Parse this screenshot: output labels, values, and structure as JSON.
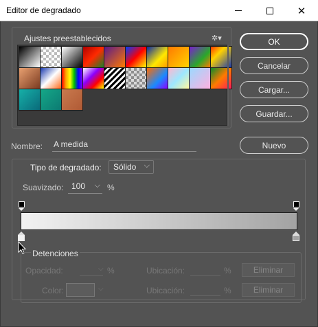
{
  "window": {
    "title": "Editor de degradado",
    "minimize_icon": "minimize-icon",
    "maximize_icon": "maximize-icon",
    "close_icon": "close-icon",
    "close_glyph": "✕"
  },
  "presets": {
    "title": "Ajustes preestablecidos",
    "gear_glyph": "✲▾",
    "gear_icon": "gear-icon",
    "swatches": [
      {
        "bg": "linear-gradient(135deg,#000 0%,#fff 100%)"
      },
      {
        "bg": "repeating-conic-gradient(#bdbdbd 0 25%, #ffffff 0 50%) 0 0/8px 8px"
      },
      {
        "bg": "linear-gradient(135deg,#fff 0%,#000 100%)"
      },
      {
        "bg": "linear-gradient(135deg,#b00000 0%,#ff2a00 50%,#1a7f2a 100%)"
      },
      {
        "bg": "linear-gradient(135deg,#5a1a8a 0%,#ff7a00 100%)"
      },
      {
        "bg": "linear-gradient(135deg,#003cff 0%,#ff0000 50%,#ffff00 100%)"
      },
      {
        "bg": "linear-gradient(135deg,#0a2aa5 0%,#ffe800 60%,#ff9b00 100%)"
      },
      {
        "bg": "linear-gradient(135deg,#ff7a00 0%,#ffd400 100%)"
      },
      {
        "bg": "linear-gradient(135deg,#7a1fd0 0%,#2aa82a 60%,#ff7a00 100%)"
      },
      {
        "bg": "linear-gradient(135deg,#ff3a00 0%,#ffd200 35%,#1a3ab0 100%)"
      },
      {
        "bg": "linear-gradient(135deg,#e8a070 0%,#7a3a20 100%)"
      },
      {
        "bg": "linear-gradient(135deg,#1a3ab0 0%,#ffffff 50%,#ff6a1a 100%)"
      },
      {
        "bg": "linear-gradient(90deg,#ff0000,#ffa500,#ffff00,#00c000,#0000ff,#8b00ff)"
      },
      {
        "bg": "linear-gradient(135deg,#ffffff 0%,#8b00ff 40%,#ff0000 70%,#ffff00 100%)"
      },
      {
        "bg": "repeating-linear-gradient(135deg,#000 0 3px,#ffffff 3px 6px)"
      },
      {
        "bg": "repeating-conic-gradient(#8e8e8e 0 25%, #d9d9d9 0 50%) 0 0/8px 8px"
      },
      {
        "bg": "linear-gradient(135deg,#ff6a00 0%,#1a8aff 60%,#8b00ff 100%)"
      },
      {
        "bg": "linear-gradient(135deg,#ffb7d0 0%,#9de7ff 50%,#fff8a0 100%)"
      },
      {
        "bg": "linear-gradient(135deg,#9bd9ff 0%,#ffb0e0 100%)"
      },
      {
        "bg": "linear-gradient(135deg,#0a8a2a 0%,#ff7a00 50%,#ff1a5a 100%)"
      },
      {
        "bg": "linear-gradient(135deg,#16b0a8 0%,#0a6a7a 100%)"
      },
      {
        "bg": "linear-gradient(135deg,#15a888 0%,#0c7a72 100%)"
      },
      {
        "bg": "linear-gradient(135deg,#c97a4e 0%,#b05a35 100%)"
      }
    ]
  },
  "buttons": {
    "ok": "OK",
    "cancel": "Cancelar",
    "load": "Cargar...",
    "save": "Guardar...",
    "new": "Nuevo"
  },
  "name": {
    "label": "Nombre:",
    "value": "A medida"
  },
  "gradient": {
    "type_label": "Tipo de degradado:",
    "type_value": "Sólido",
    "smoothness_label": "Suavizado:",
    "smoothness_value": "100",
    "smoothness_unit": "%",
    "bar_colors": [
      "#f2f2f2",
      "#a3a3a3"
    ]
  },
  "stops": {
    "title": "Detenciones",
    "opacity_label": "Opacidad:",
    "opacity_unit": "%",
    "location_label_1": "Ubicación:",
    "location_unit_1": "%",
    "delete_1": "Eliminar",
    "color_label": "Color:",
    "location_label_2": "Ubicación:",
    "location_unit_2": "%",
    "delete_2": "Eliminar"
  }
}
